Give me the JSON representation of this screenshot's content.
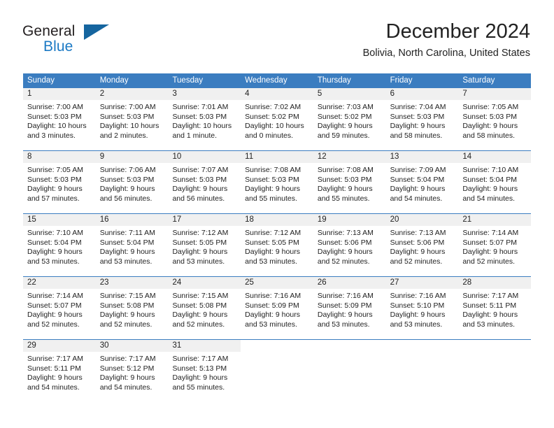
{
  "brand": {
    "line1": "General",
    "line2": "Blue",
    "flag_icon": "triangle-flag-icon",
    "accent_color": "#1b79c4"
  },
  "header": {
    "title": "December 2024",
    "location": "Bolivia, North Carolina, United States"
  },
  "theme": {
    "header_bg": "#3b7dc0",
    "day_number_bg": "#f0f0f0",
    "text": "#222222"
  },
  "weekdays": [
    "Sunday",
    "Monday",
    "Tuesday",
    "Wednesday",
    "Thursday",
    "Friday",
    "Saturday"
  ],
  "weeks": [
    [
      {
        "day": "1",
        "sunrise": "Sunrise: 7:00 AM",
        "sunset": "Sunset: 5:03 PM",
        "daylight1": "Daylight: 10 hours",
        "daylight2": "and 3 minutes."
      },
      {
        "day": "2",
        "sunrise": "Sunrise: 7:00 AM",
        "sunset": "Sunset: 5:03 PM",
        "daylight1": "Daylight: 10 hours",
        "daylight2": "and 2 minutes."
      },
      {
        "day": "3",
        "sunrise": "Sunrise: 7:01 AM",
        "sunset": "Sunset: 5:03 PM",
        "daylight1": "Daylight: 10 hours",
        "daylight2": "and 1 minute."
      },
      {
        "day": "4",
        "sunrise": "Sunrise: 7:02 AM",
        "sunset": "Sunset: 5:02 PM",
        "daylight1": "Daylight: 10 hours",
        "daylight2": "and 0 minutes."
      },
      {
        "day": "5",
        "sunrise": "Sunrise: 7:03 AM",
        "sunset": "Sunset: 5:02 PM",
        "daylight1": "Daylight: 9 hours",
        "daylight2": "and 59 minutes."
      },
      {
        "day": "6",
        "sunrise": "Sunrise: 7:04 AM",
        "sunset": "Sunset: 5:03 PM",
        "daylight1": "Daylight: 9 hours",
        "daylight2": "and 58 minutes."
      },
      {
        "day": "7",
        "sunrise": "Sunrise: 7:05 AM",
        "sunset": "Sunset: 5:03 PM",
        "daylight1": "Daylight: 9 hours",
        "daylight2": "and 58 minutes."
      }
    ],
    [
      {
        "day": "8",
        "sunrise": "Sunrise: 7:05 AM",
        "sunset": "Sunset: 5:03 PM",
        "daylight1": "Daylight: 9 hours",
        "daylight2": "and 57 minutes."
      },
      {
        "day": "9",
        "sunrise": "Sunrise: 7:06 AM",
        "sunset": "Sunset: 5:03 PM",
        "daylight1": "Daylight: 9 hours",
        "daylight2": "and 56 minutes."
      },
      {
        "day": "10",
        "sunrise": "Sunrise: 7:07 AM",
        "sunset": "Sunset: 5:03 PM",
        "daylight1": "Daylight: 9 hours",
        "daylight2": "and 56 minutes."
      },
      {
        "day": "11",
        "sunrise": "Sunrise: 7:08 AM",
        "sunset": "Sunset: 5:03 PM",
        "daylight1": "Daylight: 9 hours",
        "daylight2": "and 55 minutes."
      },
      {
        "day": "12",
        "sunrise": "Sunrise: 7:08 AM",
        "sunset": "Sunset: 5:03 PM",
        "daylight1": "Daylight: 9 hours",
        "daylight2": "and 55 minutes."
      },
      {
        "day": "13",
        "sunrise": "Sunrise: 7:09 AM",
        "sunset": "Sunset: 5:04 PM",
        "daylight1": "Daylight: 9 hours",
        "daylight2": "and 54 minutes."
      },
      {
        "day": "14",
        "sunrise": "Sunrise: 7:10 AM",
        "sunset": "Sunset: 5:04 PM",
        "daylight1": "Daylight: 9 hours",
        "daylight2": "and 54 minutes."
      }
    ],
    [
      {
        "day": "15",
        "sunrise": "Sunrise: 7:10 AM",
        "sunset": "Sunset: 5:04 PM",
        "daylight1": "Daylight: 9 hours",
        "daylight2": "and 53 minutes."
      },
      {
        "day": "16",
        "sunrise": "Sunrise: 7:11 AM",
        "sunset": "Sunset: 5:04 PM",
        "daylight1": "Daylight: 9 hours",
        "daylight2": "and 53 minutes."
      },
      {
        "day": "17",
        "sunrise": "Sunrise: 7:12 AM",
        "sunset": "Sunset: 5:05 PM",
        "daylight1": "Daylight: 9 hours",
        "daylight2": "and 53 minutes."
      },
      {
        "day": "18",
        "sunrise": "Sunrise: 7:12 AM",
        "sunset": "Sunset: 5:05 PM",
        "daylight1": "Daylight: 9 hours",
        "daylight2": "and 53 minutes."
      },
      {
        "day": "19",
        "sunrise": "Sunrise: 7:13 AM",
        "sunset": "Sunset: 5:06 PM",
        "daylight1": "Daylight: 9 hours",
        "daylight2": "and 52 minutes."
      },
      {
        "day": "20",
        "sunrise": "Sunrise: 7:13 AM",
        "sunset": "Sunset: 5:06 PM",
        "daylight1": "Daylight: 9 hours",
        "daylight2": "and 52 minutes."
      },
      {
        "day": "21",
        "sunrise": "Sunrise: 7:14 AM",
        "sunset": "Sunset: 5:07 PM",
        "daylight1": "Daylight: 9 hours",
        "daylight2": "and 52 minutes."
      }
    ],
    [
      {
        "day": "22",
        "sunrise": "Sunrise: 7:14 AM",
        "sunset": "Sunset: 5:07 PM",
        "daylight1": "Daylight: 9 hours",
        "daylight2": "and 52 minutes."
      },
      {
        "day": "23",
        "sunrise": "Sunrise: 7:15 AM",
        "sunset": "Sunset: 5:08 PM",
        "daylight1": "Daylight: 9 hours",
        "daylight2": "and 52 minutes."
      },
      {
        "day": "24",
        "sunrise": "Sunrise: 7:15 AM",
        "sunset": "Sunset: 5:08 PM",
        "daylight1": "Daylight: 9 hours",
        "daylight2": "and 52 minutes."
      },
      {
        "day": "25",
        "sunrise": "Sunrise: 7:16 AM",
        "sunset": "Sunset: 5:09 PM",
        "daylight1": "Daylight: 9 hours",
        "daylight2": "and 53 minutes."
      },
      {
        "day": "26",
        "sunrise": "Sunrise: 7:16 AM",
        "sunset": "Sunset: 5:09 PM",
        "daylight1": "Daylight: 9 hours",
        "daylight2": "and 53 minutes."
      },
      {
        "day": "27",
        "sunrise": "Sunrise: 7:16 AM",
        "sunset": "Sunset: 5:10 PM",
        "daylight1": "Daylight: 9 hours",
        "daylight2": "and 53 minutes."
      },
      {
        "day": "28",
        "sunrise": "Sunrise: 7:17 AM",
        "sunset": "Sunset: 5:11 PM",
        "daylight1": "Daylight: 9 hours",
        "daylight2": "and 53 minutes."
      }
    ],
    [
      {
        "day": "29",
        "sunrise": "Sunrise: 7:17 AM",
        "sunset": "Sunset: 5:11 PM",
        "daylight1": "Daylight: 9 hours",
        "daylight2": "and 54 minutes."
      },
      {
        "day": "30",
        "sunrise": "Sunrise: 7:17 AM",
        "sunset": "Sunset: 5:12 PM",
        "daylight1": "Daylight: 9 hours",
        "daylight2": "and 54 minutes."
      },
      {
        "day": "31",
        "sunrise": "Sunrise: 7:17 AM",
        "sunset": "Sunset: 5:13 PM",
        "daylight1": "Daylight: 9 hours",
        "daylight2": "and 55 minutes."
      },
      {
        "day": "",
        "sunrise": "",
        "sunset": "",
        "daylight1": "",
        "daylight2": ""
      },
      {
        "day": "",
        "sunrise": "",
        "sunset": "",
        "daylight1": "",
        "daylight2": ""
      },
      {
        "day": "",
        "sunrise": "",
        "sunset": "",
        "daylight1": "",
        "daylight2": ""
      },
      {
        "day": "",
        "sunrise": "",
        "sunset": "",
        "daylight1": "",
        "daylight2": ""
      }
    ]
  ]
}
